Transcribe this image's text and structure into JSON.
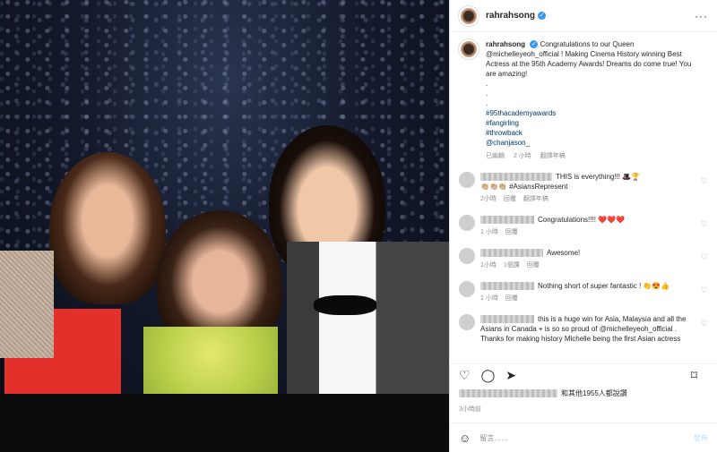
{
  "post": {
    "username": "rahrahsong",
    "verified_mark": "✓",
    "more_icon": "···",
    "caption_lines": [
      "Congratulations to our Queen",
      "@michelleyeoh_official ! Making Cinema History winning Best Actress at the 95th Academy Awards! Dreams do come true! You are amazing!"
    ],
    "dots": [
      ".",
      ".",
      "."
    ],
    "hashtags": [
      "#95thacademyawards",
      "#fangirling",
      "#throwback",
      "@chanjason_"
    ],
    "caption_meta": {
      "edited": "已編輯",
      "time": "2 小時",
      "translate": "翻譯年稿"
    },
    "comments": [
      {
        "text": "THIS is everything!!!",
        "emoji": "🎩🏆",
        "line2": "👏🏼👏🏼👏🏼 #AsiansRepresent",
        "meta": [
          "2小時",
          "回覆",
          "翻譯年稿"
        ]
      },
      {
        "text": "Congratulations!!!!",
        "emoji": "❤️❤️❤️",
        "line2": "",
        "meta": [
          "1 小時",
          "回覆"
        ]
      },
      {
        "text": "Awesome!",
        "emoji": "",
        "line2": "",
        "meta": [
          "1小時",
          "1個讚",
          "回覆"
        ]
      },
      {
        "text": "Nothing short of super fantastic !",
        "emoji": "👏😍👍",
        "line2": "",
        "meta": [
          "1 小時",
          "回覆"
        ]
      },
      {
        "text": "this is a huge win for Asia, Malaysia and all the Asians in Canada + is so so proud of @michelleyeoh_official . Thanks for making history Michelle being the first Asian actress",
        "emoji": "",
        "line2": "",
        "meta": []
      }
    ],
    "likes_text": "和其他1955人都說讚",
    "time_ago": "3小時前",
    "comment_placeholder": "留言……",
    "post_button": "發佈"
  },
  "icons": {
    "like": "♡",
    "comment": "◯",
    "share": "➤",
    "bookmark": "⌑",
    "emoji": "☺"
  }
}
